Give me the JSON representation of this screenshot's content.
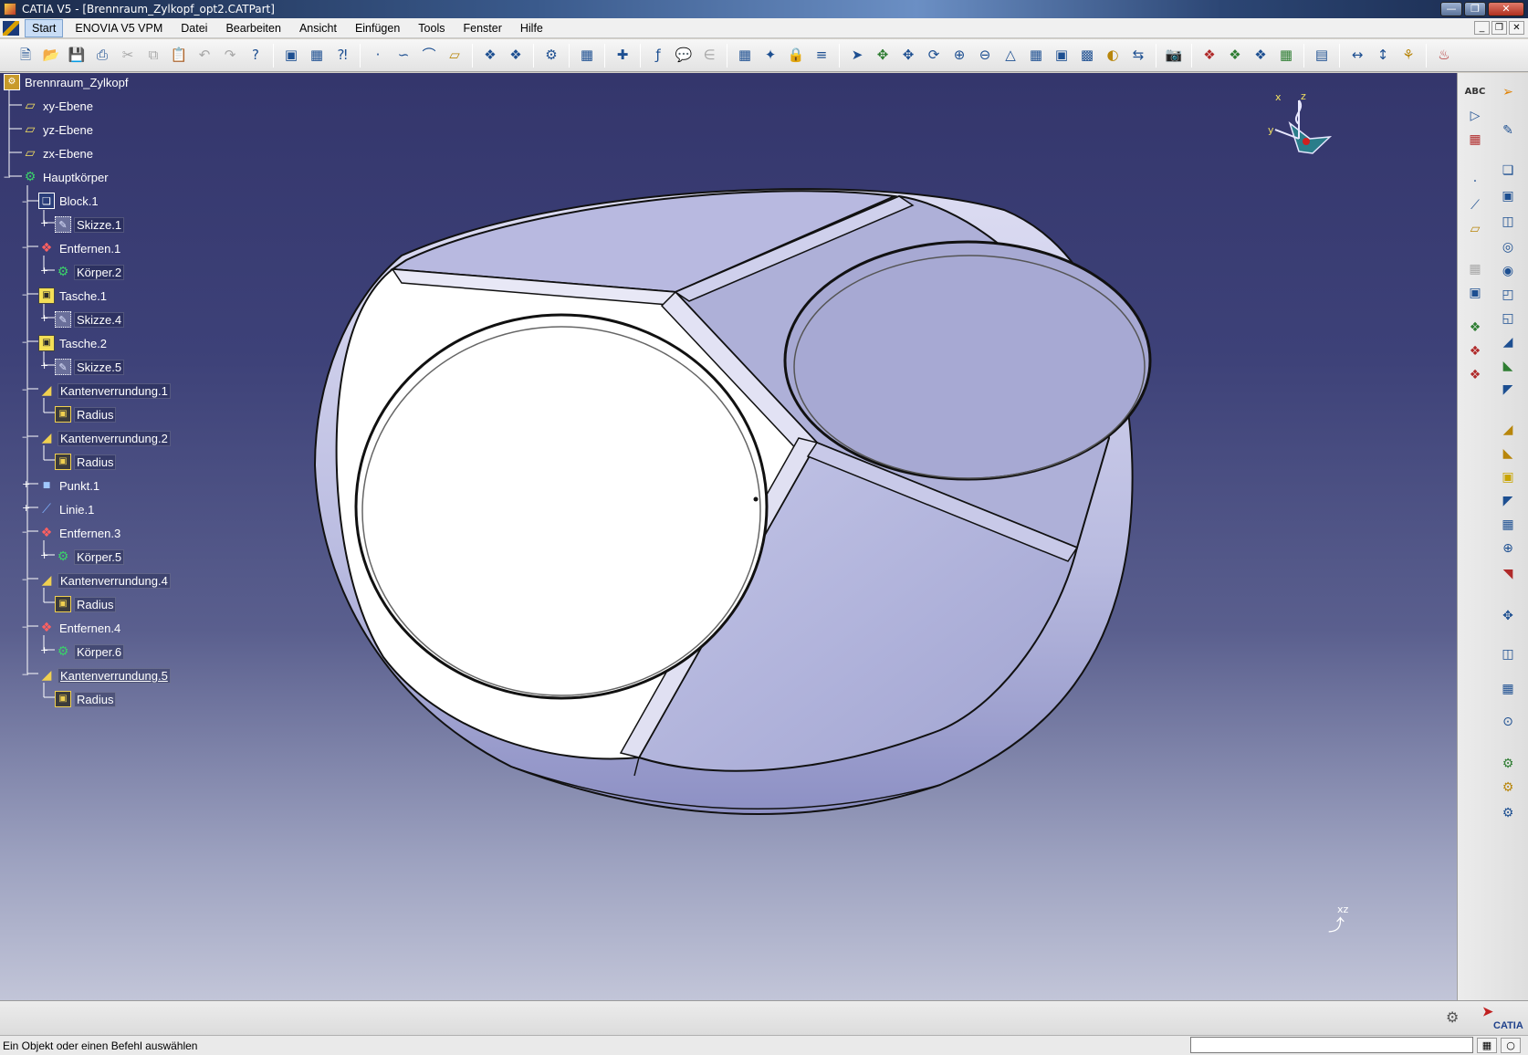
{
  "window": {
    "title": "CATIA V5 - [Brennraum_Zylkopf_opt2.CATPart]",
    "min_icon": "minimize-icon",
    "max_icon": "restore-icon",
    "close_icon": "close-icon"
  },
  "menu": {
    "items": [
      "Start",
      "ENOVIA V5 VPM",
      "Datei",
      "Bearbeiten",
      "Ansicht",
      "Einfügen",
      "Tools",
      "Fenster",
      "Hilfe"
    ]
  },
  "toolbar": {
    "icons": [
      "new-icon",
      "open-icon",
      "save-icon",
      "print-icon",
      "cut-icon",
      "copy-icon",
      "paste-icon",
      "undo-icon",
      "redo-icon",
      "whats-this-icon",
      "catalog-icon",
      "knowledge-icon",
      "query-icon",
      "point-icon",
      "spline-icon",
      "curve-icon",
      "plane-icon",
      "product-icon",
      "product2-icon",
      "workbench-icon",
      "grid-icon",
      "snap-icon",
      "formula-icon",
      "comment-icon",
      "param-icon",
      "table-icon",
      "compass-tool-icon",
      "lock-icon",
      "measure-icon",
      "fly-icon",
      "fit-all-icon",
      "pan-icon",
      "rotate-icon",
      "zoom-in-icon",
      "zoom-out-icon",
      "normal-view-icon",
      "multi-view-icon",
      "iso-view-icon",
      "shading-icon",
      "hide-show-icon",
      "swap-icon",
      "capture-icon",
      "render-icon",
      "material-icon",
      "texture-icon",
      "apply-icon",
      "analysis-icon",
      "measure-between-icon",
      "measure-item-icon",
      "light-icon"
    ]
  },
  "tree": {
    "nodes": [
      {
        "label": "Brennraum_Zylkopf",
        "icon": "part-icon"
      },
      {
        "label": "xy-Ebene",
        "icon": "plane-icon"
      },
      {
        "label": "yz-Ebene",
        "icon": "plane-icon"
      },
      {
        "label": "zx-Ebene",
        "icon": "plane-icon"
      },
      {
        "label": "Hauptkörper",
        "icon": "body-gear-icon"
      },
      {
        "label": "Block.1",
        "icon": "pad-icon"
      },
      {
        "label": "Skizze.1",
        "icon": "sketch-icon"
      },
      {
        "label": "Entfernen.1",
        "icon": "remove-icon"
      },
      {
        "label": "Körper.2",
        "icon": "body-icon"
      },
      {
        "label": "Tasche.1",
        "icon": "pocket-icon"
      },
      {
        "label": "Skizze.4",
        "icon": "sketch-icon"
      },
      {
        "label": "Tasche.2",
        "icon": "pocket-icon"
      },
      {
        "label": "Skizze.5",
        "icon": "sketch-icon"
      },
      {
        "label": "Kantenverrundung.1",
        "icon": "edge-fillet-icon"
      },
      {
        "label": "Radius",
        "icon": "radius-icon"
      },
      {
        "label": "Kantenverrundung.2",
        "icon": "edge-fillet-icon"
      },
      {
        "label": "Radius",
        "icon": "radius-icon"
      },
      {
        "label": "Punkt.1",
        "icon": "point-icon"
      },
      {
        "label": "Linie.1",
        "icon": "line-icon"
      },
      {
        "label": "Entfernen.3",
        "icon": "remove-icon"
      },
      {
        "label": "Körper.5",
        "icon": "body-icon"
      },
      {
        "label": "Kantenverrundung.4",
        "icon": "edge-fillet-icon"
      },
      {
        "label": "Radius",
        "icon": "radius-icon"
      },
      {
        "label": "Entfernen.4",
        "icon": "remove-icon"
      },
      {
        "label": "Körper.6",
        "icon": "body-icon"
      },
      {
        "label": "Kantenverrundung.5",
        "icon": "edge-fillet-icon"
      },
      {
        "label": "Radius",
        "icon": "radius-icon"
      }
    ]
  },
  "compass": {
    "axis_x": "x",
    "axis_y": "y",
    "axis_z": "z"
  },
  "viewport_axis": {
    "label": "xz"
  },
  "status": {
    "message": "Ein Objekt oder einen Befehl auswählen",
    "command_input": ""
  },
  "brand": {
    "logo_text": "CATIA"
  },
  "colors": {
    "viewport_top": "#34366c",
    "viewport_bottom": "#c2c5d8",
    "model_face": "#b4b5dc",
    "selected_face": "#ffffff"
  }
}
